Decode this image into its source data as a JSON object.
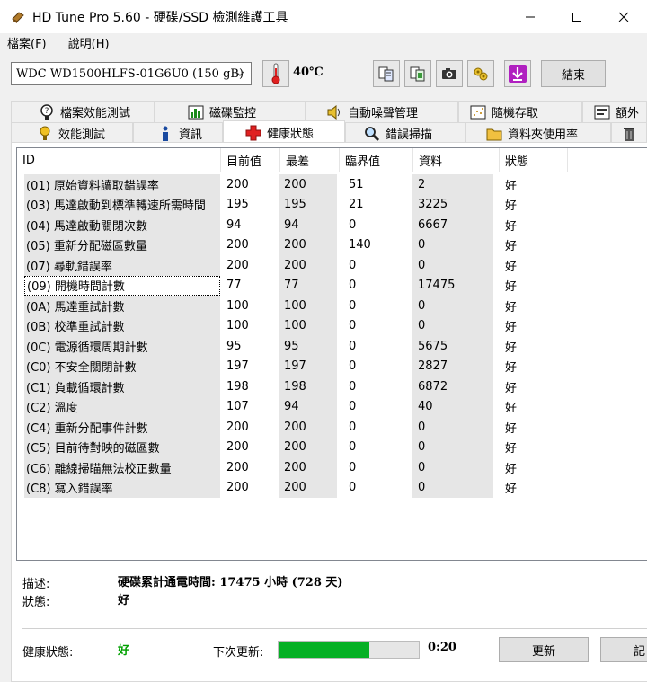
{
  "window": {
    "title": "HD Tune Pro 5.60 - 硬碟/SSD 檢測維護工具"
  },
  "menu": {
    "file": "檔案(F)",
    "help": "說明(H)"
  },
  "toolbar": {
    "drive": "WDC WD1500HLFS-01G6U0 (150 gB)",
    "temperature": "40℃",
    "exit_label": "結束"
  },
  "tabs": {
    "row1": [
      "檔案效能測試",
      "磁碟監控",
      "自動噪聲管理",
      "隨機存取",
      "額外"
    ],
    "row2": [
      "效能測試",
      "資訊",
      "健康狀態",
      "錯誤掃描",
      "資料夾使用率"
    ],
    "active": "健康狀態"
  },
  "table": {
    "headers": [
      "ID",
      "目前值",
      "最差",
      "臨界值",
      "資料",
      "狀態"
    ],
    "rows": [
      [
        "(01) 原始資料讀取錯誤率",
        "200",
        "200",
        "51",
        "2",
        "好"
      ],
      [
        "(03) 馬達啟動到標準轉速所需時間",
        "195",
        "195",
        "21",
        "3225",
        "好"
      ],
      [
        "(04) 馬達啟動關閉次數",
        "94",
        "94",
        "0",
        "6667",
        "好"
      ],
      [
        "(05) 重新分配磁區數量",
        "200",
        "200",
        "140",
        "0",
        "好"
      ],
      [
        "(07) 尋軌錯誤率",
        "200",
        "200",
        "0",
        "0",
        "好"
      ],
      [
        "(09) 開機時間計數",
        "77",
        "77",
        "0",
        "17475",
        "好"
      ],
      [
        "(0A) 馬達重試計數",
        "100",
        "100",
        "0",
        "0",
        "好"
      ],
      [
        "(0B) 校準重試計數",
        "100",
        "100",
        "0",
        "0",
        "好"
      ],
      [
        "(0C) 電源循環周期計數",
        "95",
        "95",
        "0",
        "5675",
        "好"
      ],
      [
        "(C0) 不安全關閉計數",
        "197",
        "197",
        "0",
        "2827",
        "好"
      ],
      [
        "(C1) 負載循環計數",
        "198",
        "198",
        "0",
        "6872",
        "好"
      ],
      [
        "(C2) 溫度",
        "107",
        "94",
        "0",
        "40",
        "好"
      ],
      [
        "(C4) 重新分配事件計數",
        "200",
        "200",
        "0",
        "0",
        "好"
      ],
      [
        "(C5) 目前待對映的磁區數",
        "200",
        "200",
        "0",
        "0",
        "好"
      ],
      [
        "(C6) 離線掃瞄無法校正數量",
        "200",
        "200",
        "0",
        "0",
        "好"
      ],
      [
        "(C8) 寫入錯誤率",
        "200",
        "200",
        "0",
        "0",
        "好"
      ]
    ]
  },
  "details": {
    "desc_label": "描述:",
    "desc_value": "硬碟累計通電時間: 17475 小時 (728 天)",
    "status_label": "狀態:",
    "status_value": "好"
  },
  "footer": {
    "health_label": "健康狀態:",
    "health_value": "好",
    "next_update_label": "下次更新:",
    "progress_fraction": 0.65,
    "countdown": "0:20",
    "refresh_label": "更新",
    "log_label": "記"
  }
}
